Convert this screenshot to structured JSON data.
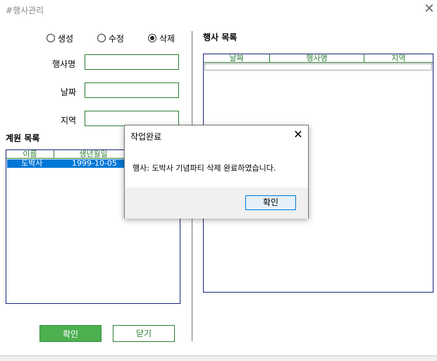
{
  "window": {
    "title": "#행사관리",
    "close_glyph": "✕"
  },
  "form": {
    "mode_options": [
      {
        "label": "생성",
        "selected": false
      },
      {
        "label": "수정",
        "selected": false
      },
      {
        "label": "삭제",
        "selected": true
      }
    ],
    "fields": [
      {
        "label": "행사명",
        "value": ""
      },
      {
        "label": "날짜",
        "value": ""
      },
      {
        "label": "지역",
        "value": ""
      }
    ]
  },
  "member_list": {
    "title": "계원 목록",
    "columns": [
      "이름",
      "생년월일"
    ],
    "rows": [
      {
        "name": "도박사",
        "birth": "1999-10-05",
        "selected": true
      }
    ]
  },
  "event_list": {
    "title": "행사 목록",
    "columns": [
      "날짜",
      "행사명",
      "지역"
    ],
    "rows": []
  },
  "buttons": {
    "confirm": "확인",
    "close": "닫기"
  },
  "dialog": {
    "title": "작업완료",
    "close_glyph": "✕",
    "message": "행사: 도박사 기념파티 삭제 완료하였습니다.",
    "ok": "확인"
  },
  "colors": {
    "accent_green": "#4caf50",
    "selection_blue": "#0078d7"
  }
}
